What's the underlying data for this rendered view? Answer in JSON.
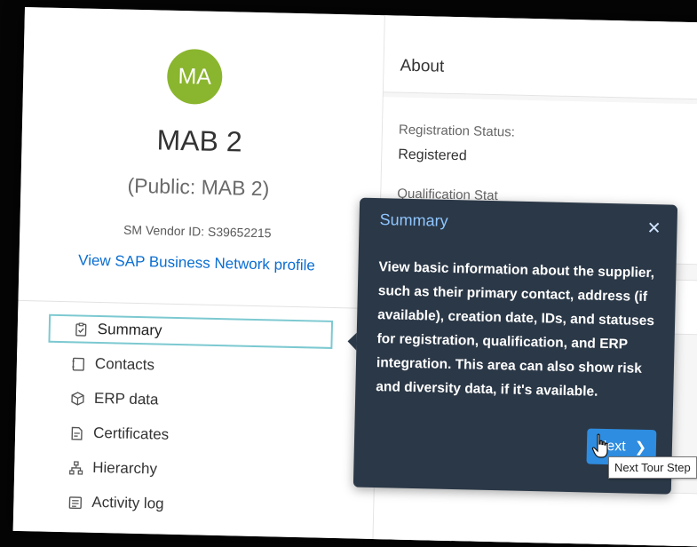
{
  "profile": {
    "initials": "MA",
    "avatar_color": "#8ab52e",
    "name": "MAB 2",
    "public_name": "(Public: MAB 2)",
    "vendor_id": "SM Vendor ID:  S39652215",
    "network_link": "View SAP Business Network profile"
  },
  "nav": {
    "items": [
      {
        "label": "Summary",
        "icon": "clipboard-check-icon",
        "active": true
      },
      {
        "label": "Contacts",
        "icon": "contact-card-icon"
      },
      {
        "label": "ERP data",
        "icon": "cube-icon"
      },
      {
        "label": "Certificates",
        "icon": "certificate-icon"
      },
      {
        "label": "Hierarchy",
        "icon": "hierarchy-icon"
      },
      {
        "label": "Activity log",
        "icon": "activity-log-icon"
      }
    ]
  },
  "about": {
    "title": "About",
    "registration_label": "Registration Status:",
    "registration_value": "Registered",
    "qualification_label": "Qualification Stat"
  },
  "tour": {
    "title": "Summary",
    "close_icon": "close-icon",
    "body": "View basic information about the supplier, such as their primary contact, address (if available), creation date, IDs, and statuses for registration, qualification, and ERP integration. This area can also show risk and diversity data, if it's available.",
    "next_label": "Next",
    "next_icon": "chevron-right-icon",
    "tooltip": "Next Tour Step"
  },
  "colors": {
    "popover_bg": "#2b3847",
    "popover_title": "#8fc6ff",
    "primary_button": "#2e8de0",
    "link": "#0a6ed1",
    "active_outline": "#7cc9d1"
  }
}
